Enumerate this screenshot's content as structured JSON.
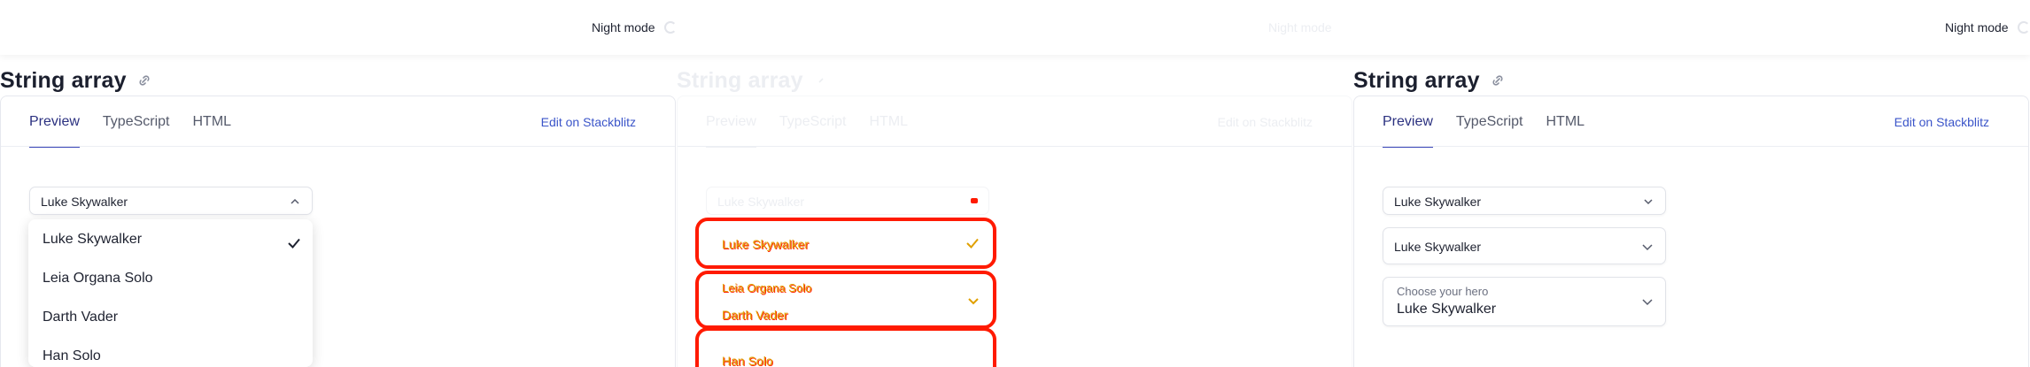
{
  "night_mode_label": "Night mode",
  "section_title": "String array",
  "tabs": [
    "Preview",
    "TypeScript",
    "HTML"
  ],
  "edit_link": "Edit on Stackblitz",
  "selected_value": "Luke Skywalker",
  "placeholder": "Choose your hero",
  "options": [
    "Luke Skywalker",
    "Leia Organa Solo",
    "Darth Vader",
    "Han Solo"
  ],
  "colors": {
    "accent": "#3b47b8",
    "link": "#3b55c9",
    "glitch_red": "#ff1a00",
    "glitch_yellow": "#e0a000"
  }
}
